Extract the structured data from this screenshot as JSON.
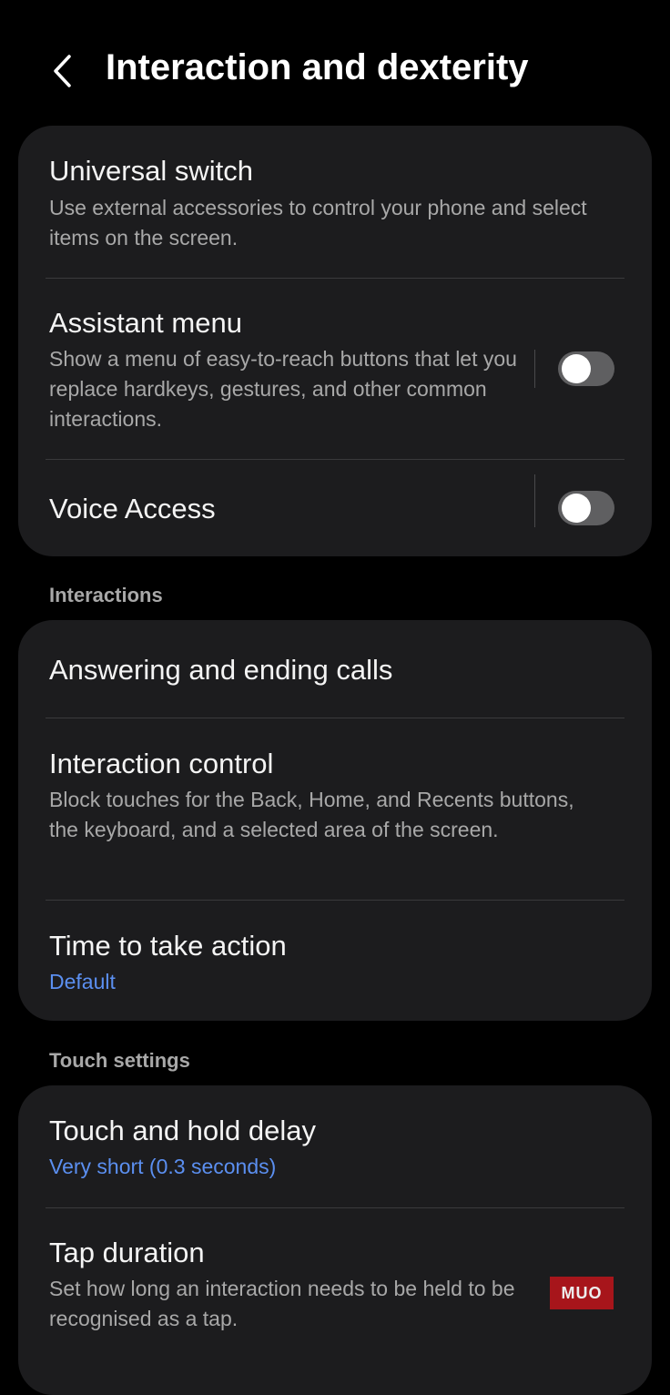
{
  "header": {
    "title": "Interaction and dexterity",
    "back_icon": "chevron-left-icon"
  },
  "card_main": {
    "universal_switch": {
      "title": "Universal switch",
      "description": "Use external accessories to control your phone and select items on the screen."
    },
    "assistant_menu": {
      "title": "Assistant menu",
      "description": "Show a menu of easy-to-reach buttons that let you replace hardkeys, gestures, and other common interactions.",
      "toggle_state": "off"
    },
    "voice_access": {
      "title": "Voice Access",
      "toggle_state": "off"
    }
  },
  "interactions": {
    "section_label": "Interactions",
    "answering_calls": {
      "title": "Answering and ending calls"
    },
    "interaction_control": {
      "title": "Interaction control",
      "description": "Block touches for the Back, Home, and Recents buttons, the keyboard, and a selected area of the screen."
    },
    "time_to_take_action": {
      "title": "Time to take action",
      "value": "Default"
    }
  },
  "touch_settings": {
    "section_label": "Touch settings",
    "touch_hold_delay": {
      "title": "Touch and hold delay",
      "value": "Very short (0.3 seconds)"
    },
    "tap_duration": {
      "title": "Tap duration",
      "description": "Set how long an interaction needs to be held to be recognised as a tap."
    }
  },
  "watermark": {
    "text": "MUO"
  },
  "colors": {
    "background": "#000000",
    "card": "#1c1c1e",
    "accent_value": "#5b8ff0",
    "toggle_off": "#5f5f61",
    "secondary_text": "#a8a8a8"
  }
}
